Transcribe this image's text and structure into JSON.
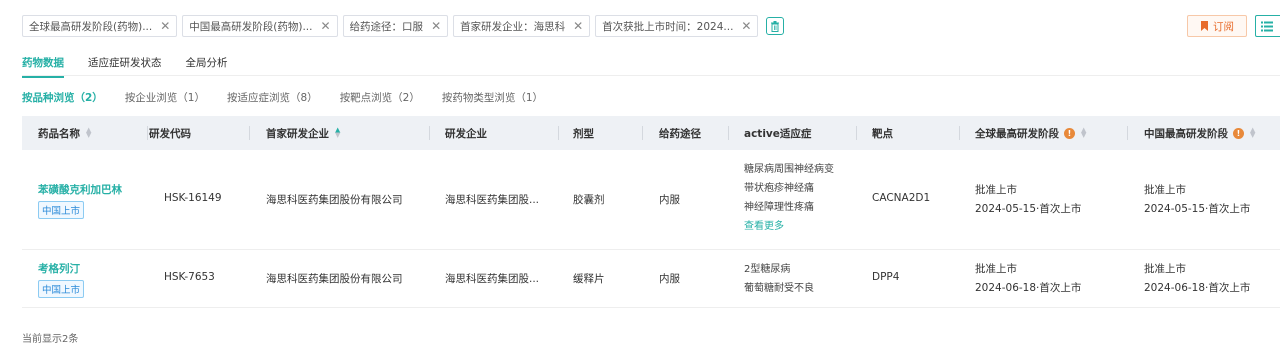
{
  "filters": [
    {
      "label": "全球最高研发阶段(药物)..."
    },
    {
      "label": "中国最高研发阶段(药物)..."
    },
    {
      "label": "给药途径：口服"
    },
    {
      "label": "首家研发企业：海思科"
    },
    {
      "label": "首次获批上市时间：2024..."
    }
  ],
  "subscribe_label": "订阅",
  "tabs": [
    "药物数据",
    "适应症研发状态",
    "全局分析"
  ],
  "subtabs": [
    "按品种浏览（2）",
    "按企业浏览（1）",
    "按适应症浏览（8）",
    "按靶点浏览（2）",
    "按药物类型浏览（1）"
  ],
  "columns": {
    "name": "药品名称",
    "code": "研发代码",
    "first_company": "首家研发企业",
    "company": "研发企业",
    "form": "剂型",
    "route": "给药途径",
    "indication": "active适应症",
    "target": "靶点",
    "global_stage": "全球最高研发阶段",
    "china_stage": "中国最高研发阶段"
  },
  "rows": [
    {
      "name": "苯磺酸克利加巴林",
      "badge": "中国上市",
      "code": "HSK-16149",
      "first_company": "海思科医药集团股份有限公司",
      "company": "海思科医药集团股...",
      "form": "胶囊剂",
      "route": "内服",
      "indications": [
        "糖尿病周围神经病变",
        "带状疱疹神经痛",
        "神经障理性疼痛"
      ],
      "more": "查看更多",
      "target": "CACNA2D1",
      "global_stage": "批准上市",
      "global_date": "2024-05-15·首次上市",
      "china_stage": "批准上市",
      "china_date": "2024-05-15·首次上市"
    },
    {
      "name": "考格列汀",
      "badge": "中国上市",
      "code": "HSK-7653",
      "first_company": "海思科医药集团股份有限公司",
      "company": "海思科医药集团股...",
      "form": "缓释片",
      "route": "内服",
      "indications": [
        "2型糖尿病",
        "葡萄糖耐受不良"
      ],
      "target": "DPP4",
      "global_stage": "批准上市",
      "global_date": "2024-06-18·首次上市",
      "china_stage": "批准上市",
      "china_date": "2024-06-18·首次上市"
    }
  ],
  "footer": "当前显示2条",
  "colors": {
    "accent": "#26b0a6",
    "badge": "#2b8ad8",
    "subscribe": "#e86b2a",
    "info": "#e8893a"
  }
}
